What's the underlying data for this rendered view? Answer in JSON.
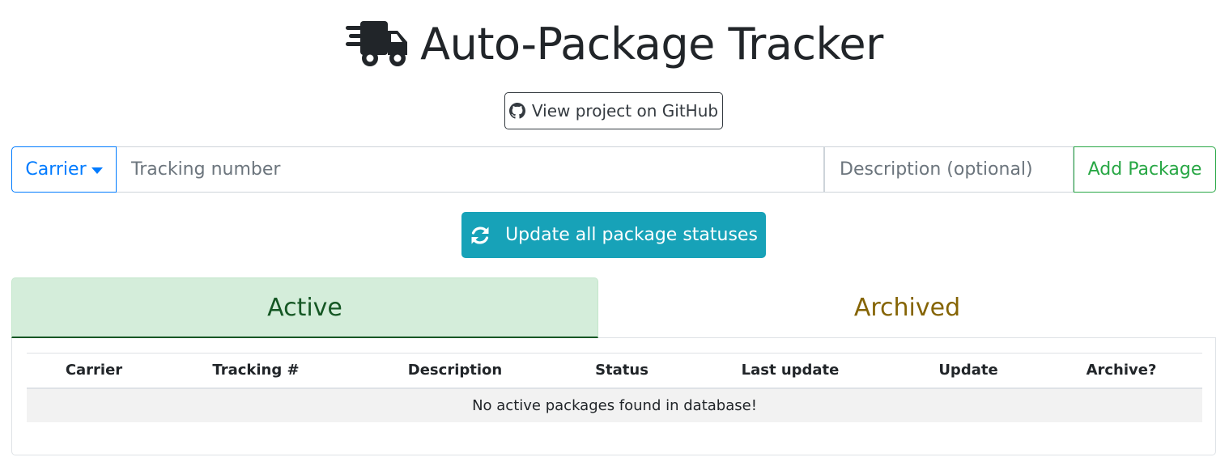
{
  "header": {
    "title": "Auto-Package Tracker",
    "icon": "shipping-fast-icon"
  },
  "github_button": {
    "label": "View project on GitHub",
    "icon": "github-icon"
  },
  "add_form": {
    "carrier_label": "Carrier",
    "tracking_placeholder": "Tracking number",
    "description_placeholder": "Description (optional)",
    "add_label": "Add Package"
  },
  "update_button": {
    "label": "Update all package statuses",
    "icon": "sync-icon"
  },
  "tabs": [
    {
      "label": "Active",
      "active": true
    },
    {
      "label": "Archived",
      "active": false
    }
  ],
  "table": {
    "headers": [
      "Carrier",
      "Tracking #",
      "Description",
      "Status",
      "Last update",
      "Update",
      "Archive?"
    ],
    "empty_message": "No active packages found in database!"
  },
  "colors": {
    "primary": "#007bff",
    "success": "#28a745",
    "info": "#17a2b8",
    "active_tab_bg": "#d4edda",
    "active_tab_text": "#155724",
    "archived_tab_text": "#856404"
  }
}
